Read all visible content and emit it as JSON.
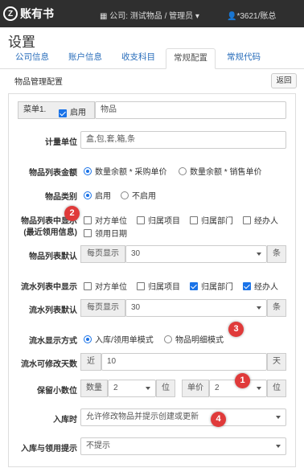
{
  "topbar": {
    "logo_mark": "Z",
    "logo_text": "账有书",
    "company": "公司: 测试物品 / 管理员",
    "user": "*3621/账总"
  },
  "title": "设置",
  "tabs": [
    "公司信息",
    "账户信息",
    "收支科目",
    "常规配置",
    "常规代码"
  ],
  "active_tab": "常规配置",
  "panel": {
    "title": "物品管理配置",
    "back": "返回"
  },
  "menu": {
    "label": "菜单1.",
    "enable": "启用",
    "name": "物品"
  },
  "unit": {
    "label": "计量单位",
    "value": "盒,包,套,箱,条"
  },
  "amount": {
    "label": "物品列表金额",
    "opt1": "数量余额 * 采购单价",
    "opt2": "数量余额 * 销售单价"
  },
  "category": {
    "label": "物品类别",
    "opt1": "启用",
    "opt2": "不启用"
  },
  "item_display": {
    "label1": "物品列表中显示",
    "label2": "(最近领用信息)",
    "opts": [
      "对方单位",
      "归属项目",
      "归属部门",
      "经办人",
      "领用日期"
    ]
  },
  "item_default": {
    "label": "物品列表默认",
    "prefix": "每页显示",
    "value": "30",
    "suffix": "条"
  },
  "flow_display": {
    "label": "流水列表中显示",
    "opts": [
      "对方单位",
      "归属项目",
      "归属部门",
      "经办人"
    ]
  },
  "flow_default": {
    "label": "流水列表默认",
    "prefix": "每页显示",
    "value": "30",
    "suffix": "条"
  },
  "flow_mode": {
    "label": "流水显示方式",
    "opt1": "入库/领用单模式",
    "opt2": "物品明细模式"
  },
  "flow_days": {
    "label": "流水可修改天数",
    "prefix": "近",
    "value": "10",
    "suffix": "天"
  },
  "decimals": {
    "label": "保留小数位",
    "qty_label": "数量",
    "qty": "2",
    "unit1": "位",
    "price_label": "单价",
    "price": "2",
    "unit2": "位"
  },
  "stock_in": {
    "label": "入库时",
    "value": "允许修改物品并提示创建或更新"
  },
  "hint": {
    "label": "入库与领用提示",
    "value": "不提示"
  },
  "badges": [
    "1",
    "2",
    "3",
    "4"
  ],
  "colors": {
    "topbar": "#2f2f2f",
    "accent": "#1a73e8",
    "badge": "#e03a3a",
    "link": "#2a6ebb"
  }
}
